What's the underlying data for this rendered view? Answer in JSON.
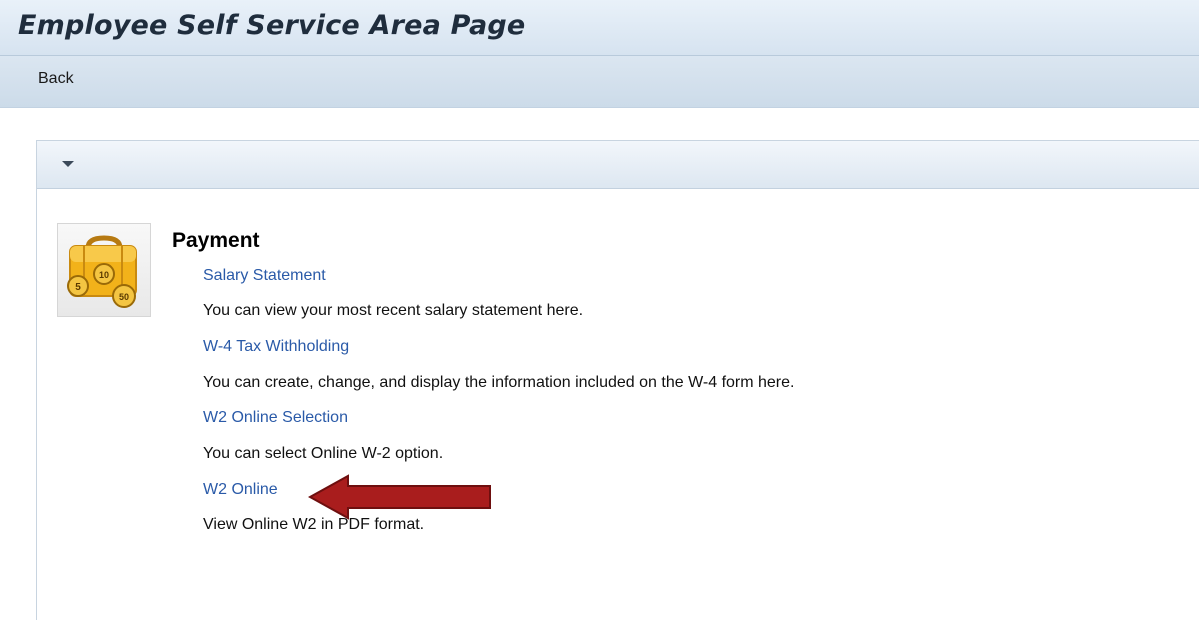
{
  "page": {
    "title": "Employee Self Service Area Page"
  },
  "toolbar": {
    "back_label": "Back"
  },
  "panel": {
    "toggle_icon": "triangle-down-icon"
  },
  "section": {
    "icon": "payment-briefcase-icon",
    "title": "Payment",
    "items": [
      {
        "link": "Salary Statement",
        "description": "You can view your most recent salary statement here."
      },
      {
        "link": "W-4 Tax Withholding",
        "description": "You can create, change, and display the information included on the W-4 form here."
      },
      {
        "link": "W2 Online Selection",
        "description": "You can select Online W-2 option."
      },
      {
        "link": "W2 Online",
        "description": "View Online W2 in PDF format."
      }
    ]
  },
  "annotation": {
    "arrow_color": "#a91d1d",
    "arrow_icon": "left-arrow-icon"
  },
  "colors": {
    "link": "#2a5aa8",
    "header_bg": "#d6e3f0"
  }
}
